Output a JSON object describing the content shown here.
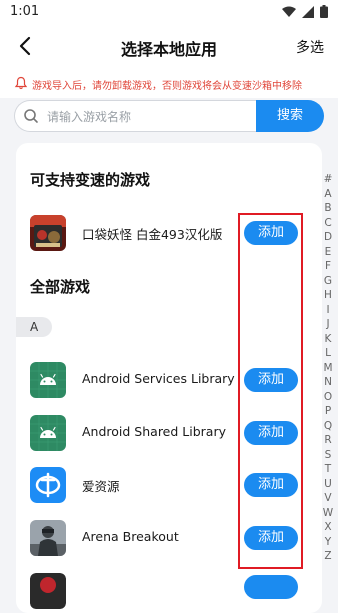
{
  "status_bar": {
    "time": "1:01"
  },
  "nav": {
    "title": "选择本地应用",
    "multi_select": "多选"
  },
  "notice": {
    "text": "游戏导入后，请勿卸载游戏，否则游戏将会从变速沙箱中移除"
  },
  "search": {
    "placeholder": "请输入游戏名称",
    "button": "搜索"
  },
  "supported_section": {
    "title": "可支持变速的游戏",
    "apps": [
      {
        "name": "口袋妖怪 白金493汉化版",
        "button": "添加"
      }
    ]
  },
  "all_section": {
    "title": "全部游戏",
    "letter": "A",
    "apps": [
      {
        "name": "Android Services Library",
        "button": "添加"
      },
      {
        "name": "Android Shared Library",
        "button": "添加"
      },
      {
        "name": "爱资源",
        "button": "添加"
      },
      {
        "name": "Arena Breakout",
        "button": "添加"
      }
    ]
  },
  "alphabet_index": [
    "#",
    "A",
    "B",
    "C",
    "D",
    "E",
    "F",
    "G",
    "H",
    "I",
    "J",
    "K",
    "L",
    "M",
    "N",
    "O",
    "P",
    "Q",
    "R",
    "S",
    "T",
    "U",
    "V",
    "W",
    "X",
    "Y",
    "Z"
  ],
  "colors": {
    "accent": "#1b8bf0",
    "warning": "#e0463a",
    "highlight": "#e01b24"
  }
}
